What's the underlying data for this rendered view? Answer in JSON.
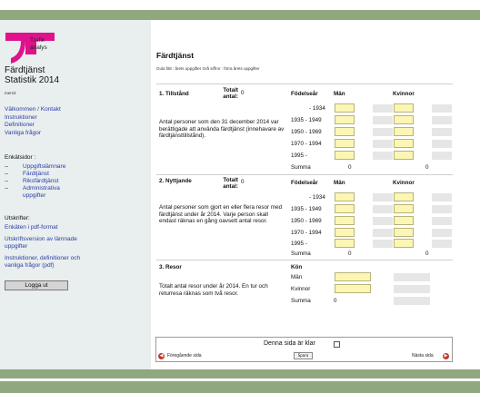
{
  "sidebar": {
    "logo_text": "Trafik\nanalys",
    "app_title": "Färdtjänst\nStatistik 2014",
    "app_sub": "mers3",
    "links": [
      "Välkommen / Kontakt",
      "Instruktioner",
      "Definitioner",
      "Vanliga frågor"
    ],
    "enkat_label": "Enkätsidor :",
    "enkat_items": [
      {
        "dash": "--",
        "label": "Uppgiftslämnare"
      },
      {
        "dash": "--",
        "label": "Färdtjänst"
      },
      {
        "dash": "--",
        "label": "Riksfärdtjänst"
      },
      {
        "dash": "--",
        "label": "Administrativa uppgifter"
      }
    ],
    "utskrifter_label": "Utskrifter:",
    "utskrifter_links": [
      "Enkäten i pdf-format",
      "Utskriftsversion av lämnade uppgifter",
      "Instruktioner, definitioner och vanliga frågor (pdf)"
    ],
    "logout": "Logga ut"
  },
  "main": {
    "title": "Färdtjänst",
    "legend": "Gula fält : årets uppgifter  Grå siffror : förra årets uppgifter",
    "col_fodelsear": "Födelseår",
    "col_man": "Män",
    "col_kvinnor": "Kvinnor",
    "col_kon": "Kön",
    "total_label": "Totalt antal:",
    "sec1": {
      "title": "1. Tillstånd",
      "total": "0",
      "desc": "Antal personer som den 31 december 2014 var berättigade att använda färdtjänst (innehavare av färdtjänsttillstånd).",
      "rows": [
        "- 1934",
        "1935 - 1949",
        "1950 - 1969",
        "1970 - 1994",
        "1995 -"
      ],
      "sum_label": "Summa",
      "sum_man": "0",
      "sum_kvinnor": "0"
    },
    "sec2": {
      "title": "2. Nyttjande",
      "total": "0",
      "desc": "Antal personer som gjort en eller flera resor med färdtjänst under år 2014. Varje person skall endast räknas en gång oavsett antal resor.",
      "rows": [
        "- 1934",
        "1935 - 1949",
        "1950 - 1969",
        "1970 - 1994",
        "1995 -"
      ],
      "sum_label": "Summa",
      "sum_man": "0",
      "sum_kvinnor": "0"
    },
    "sec3": {
      "title": "3. Resor",
      "desc": "Totalt antal resor under år 2014. En tur och returresa räknas som två resor.",
      "rows": [
        "Män",
        "Kvinnor"
      ],
      "sum_label": "Summa",
      "sum_value": "0"
    },
    "footer": {
      "klar_label": "Denna sida är klar",
      "prev": "Föregående sida",
      "save": "Spara",
      "next": "Nästa sida"
    }
  }
}
